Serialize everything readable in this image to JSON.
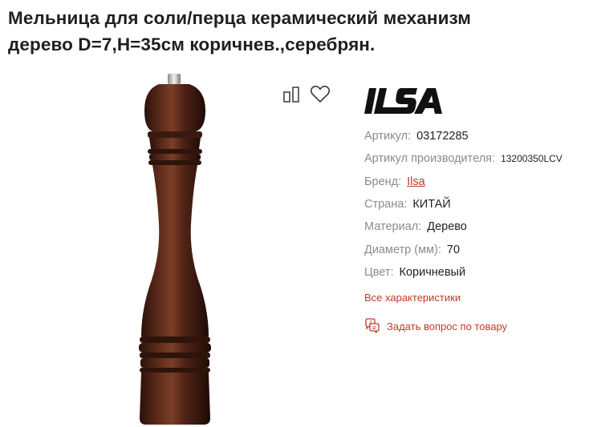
{
  "product": {
    "title_line1": "Мельница для соли/перца керамический механизм",
    "title_line2": "дерево D=7,H=35см коричнев.,серебрян.",
    "image_alt": "pepper-mill-photo"
  },
  "actions": {
    "compare_icon": "compare-icon",
    "favorite_icon": "heart-icon"
  },
  "brand": {
    "logo_text": "ILSA"
  },
  "specs": [
    {
      "label": "Артикул",
      "value": "03172285"
    },
    {
      "label": "Артикул производителя",
      "value": "13200350LCV"
    },
    {
      "label": "Бренд",
      "value": "Ilsa"
    },
    {
      "label": "Страна",
      "value": "КИТАЙ"
    },
    {
      "label": "Материал",
      "value": "Дерево"
    },
    {
      "label": "Диаметр (мм)",
      "value": "70"
    },
    {
      "label": "Цвет",
      "value": "Коричневый"
    }
  ],
  "links": {
    "all_specs": "Все характеристики",
    "ask_question": "Задать вопрос по товару",
    "ask_icon": "question-chat-icon"
  },
  "colors": {
    "accent": "#c0392b",
    "label": "#8b8b8b",
    "text": "#222222",
    "wood": "#4a2418"
  }
}
